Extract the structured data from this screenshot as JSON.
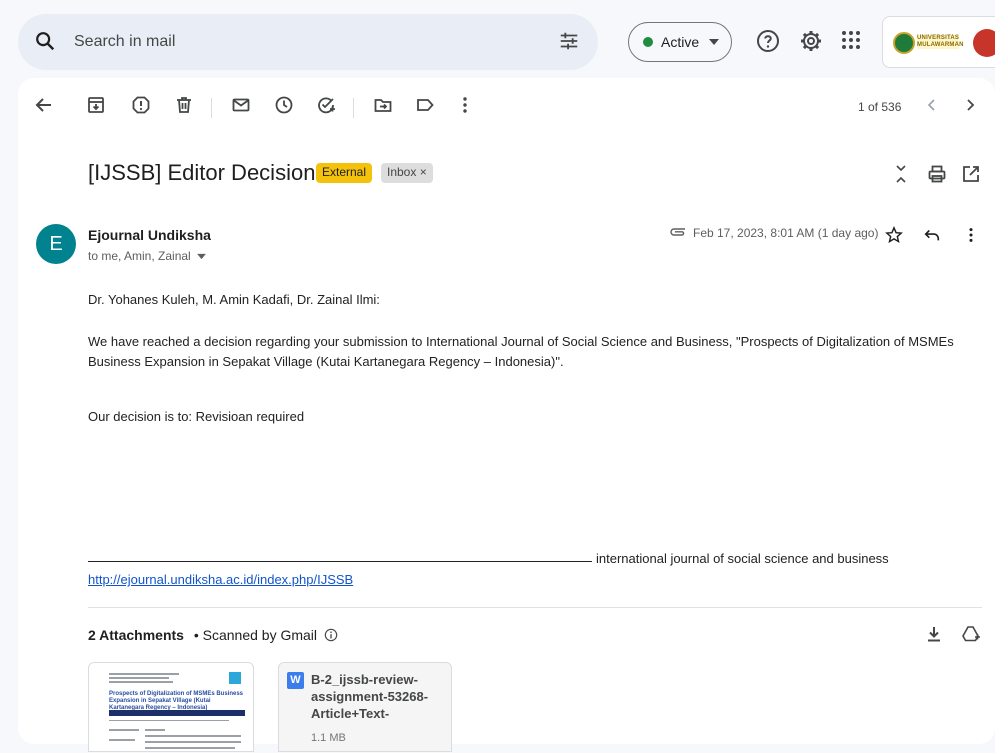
{
  "search": {
    "placeholder": "Search in mail"
  },
  "status": {
    "label": "Active"
  },
  "account": {
    "logo_text": "UNIVERSITAS MULAWARMAN"
  },
  "pager": {
    "text": "1 of 536"
  },
  "email": {
    "subject": "[IJSSB] Editor Decision",
    "labels": {
      "external": "External",
      "inbox": "Inbox ×"
    },
    "avatar_letter": "E",
    "sender": "Ejournal Undiksha",
    "recipients": "to me, Amin, Zainal",
    "date": "Feb 17, 2023, 8:01 AM (1 day ago)",
    "greeting": "Dr. Yohanes Kuleh, M. Amin Kadafi, Dr. Zainal Ilmi:",
    "paragraph1": "We have reached a decision regarding your submission to International Journal of Social Science and Business, \"Prospects of Digitalization of MSMEs Business Expansion in Sepakat Village (Kutai Kartanegara Regency – Indonesia)\".",
    "decision": "Our decision is to: Revisioan required",
    "journal_name": "international journal of social science and business",
    "link": "http://ejournal.undiksha.ac.id/index.php/IJSSB"
  },
  "attachments": {
    "count_label": "2 Attachments",
    "scanned_label": "• Scanned by Gmail",
    "thumb_title": "Prospects of Digitalization of MSMEs Business Expansion in Sepakat Village (Kutai Kartanegara Regency – Indonesia)",
    "file2_name": "B-2_ijssb-review-assignment-53268-Article+Text-",
    "file2_size": "1.1 MB",
    "file_type_letter": "W"
  },
  "colors": {
    "accent_green": "#1e8e3e",
    "external_tag": "#f4c20d",
    "avatar": "#00838f",
    "link": "#1155cc"
  }
}
